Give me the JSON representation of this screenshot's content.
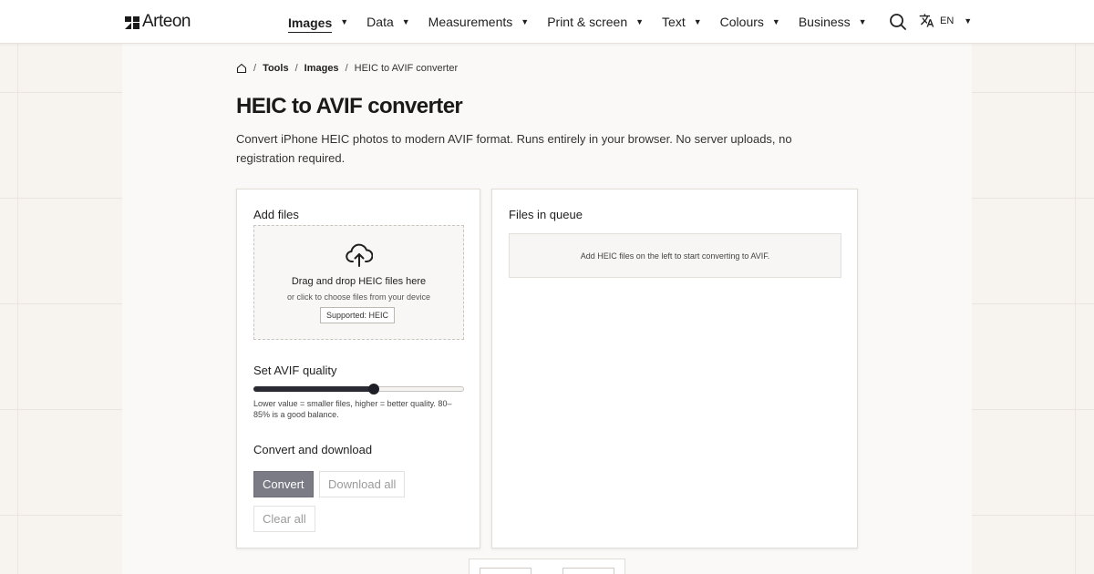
{
  "header": {
    "brand": "Arteon",
    "nav": [
      {
        "label": "Images",
        "active": true
      },
      {
        "label": "Data"
      },
      {
        "label": "Measurements"
      },
      {
        "label": "Print & screen"
      },
      {
        "label": "Text"
      },
      {
        "label": "Colours"
      },
      {
        "label": "Business"
      }
    ],
    "language": "EN",
    "icons": {
      "search": "search-icon",
      "translate": "translate-icon",
      "home": "home-icon",
      "upload": "cloud-upload-icon"
    }
  },
  "breadcrumb": {
    "items": [
      "Tools",
      "Images"
    ],
    "current": "HEIC to AVIF converter"
  },
  "page": {
    "title": "HEIC to AVIF converter",
    "description": "Convert iPhone HEIC photos to modern AVIF format. Runs entirely in your browser. No server uploads, no registration required."
  },
  "add_files": {
    "title": "Add files",
    "drop_main": "Drag and drop HEIC files here",
    "drop_sub": "or click to choose files from your device",
    "supported": "Supported: HEIC"
  },
  "quality": {
    "title": "Set AVIF quality",
    "value_fraction": 0.57,
    "hint": "Lower value = smaller files, higher = better quality. 80–85% is a good balance."
  },
  "actions": {
    "title": "Convert and download",
    "convert": "Convert",
    "download_all": "Download all",
    "clear_all": "Clear all"
  },
  "queue": {
    "title": "Files in queue",
    "empty": "Add HEIC files on the left to start converting to AVIF."
  },
  "colors": {
    "accent": "#1e1e26",
    "background": "#f7f3ef",
    "convert_button": "#7b7b86"
  }
}
